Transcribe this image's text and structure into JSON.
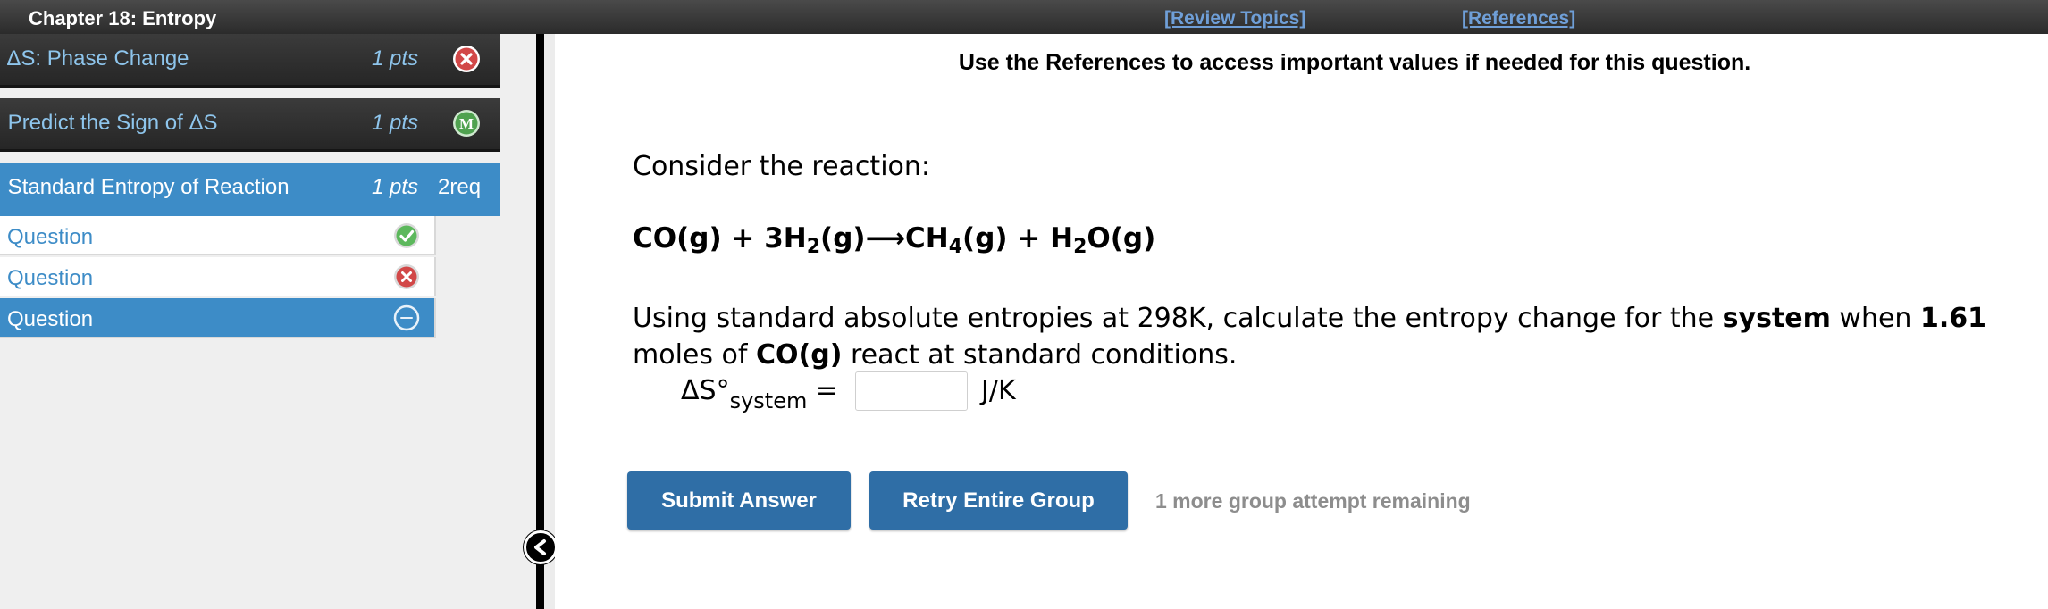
{
  "header": {
    "chapter_title": "Chapter 18: Entropy",
    "review_topics": "[Review Topics]",
    "references": "[References]"
  },
  "sidebar": {
    "topics": [
      {
        "label": "1. ΔS: Phase Change",
        "points": "1 pts",
        "status": "incorrect",
        "icon": "x-circle-icon"
      },
      {
        "label": "2. Predict the Sign of ΔS",
        "points": "1 pts",
        "status": "mastery",
        "icon": "m-circle-icon",
        "icon_text": "M"
      },
      {
        "label": "3. Standard Entropy of Reaction",
        "points": "1 pts",
        "requirement": "2req",
        "status": "active"
      }
    ],
    "questions": [
      {
        "label": "Question",
        "status": "correct",
        "icon": "check-circle-icon"
      },
      {
        "label": "Question",
        "status": "incorrect",
        "icon": "x-circle-icon"
      },
      {
        "label": "Question",
        "status": "current",
        "icon": "empty-circle-icon"
      }
    ]
  },
  "main": {
    "instructions": "Use the References to access important values if needed for this question.",
    "consider": "Consider the reaction:",
    "equation": {
      "r1": "CO(g)",
      "plus1": " + ",
      "r2_coef": "3H",
      "r2_sub": "2",
      "r2_state": "(g)",
      "arrow": "⟶",
      "p1": "CH",
      "p1_sub": "4",
      "p1_state": "(g)",
      "plus2": " + ",
      "p2": "H",
      "p2_sub": "2",
      "p2_state": "O(g)"
    },
    "prompt": {
      "part1": "Using standard absolute entropies at 298K, calculate the entropy change for the ",
      "bold1": "system",
      "part2": " when ",
      "bold2": "1.61",
      "part3": " moles of ",
      "bold3": "CO(g)",
      "part4": " react at standard conditions."
    },
    "answer": {
      "label": "ΔS°",
      "label_sub": "system",
      "equals": " =",
      "value": "",
      "unit": "J/K"
    },
    "buttons": {
      "submit": "Submit Answer",
      "retry": "Retry Entire Group"
    },
    "attempts_text": "1 more group attempt remaining"
  },
  "colors": {
    "accent_blue": "#3d8cc7",
    "button_blue": "#2f6ea6",
    "incorrect_red": "#d24848",
    "correct_green": "#5cb85c",
    "link_blue": "#6f9fd8"
  }
}
